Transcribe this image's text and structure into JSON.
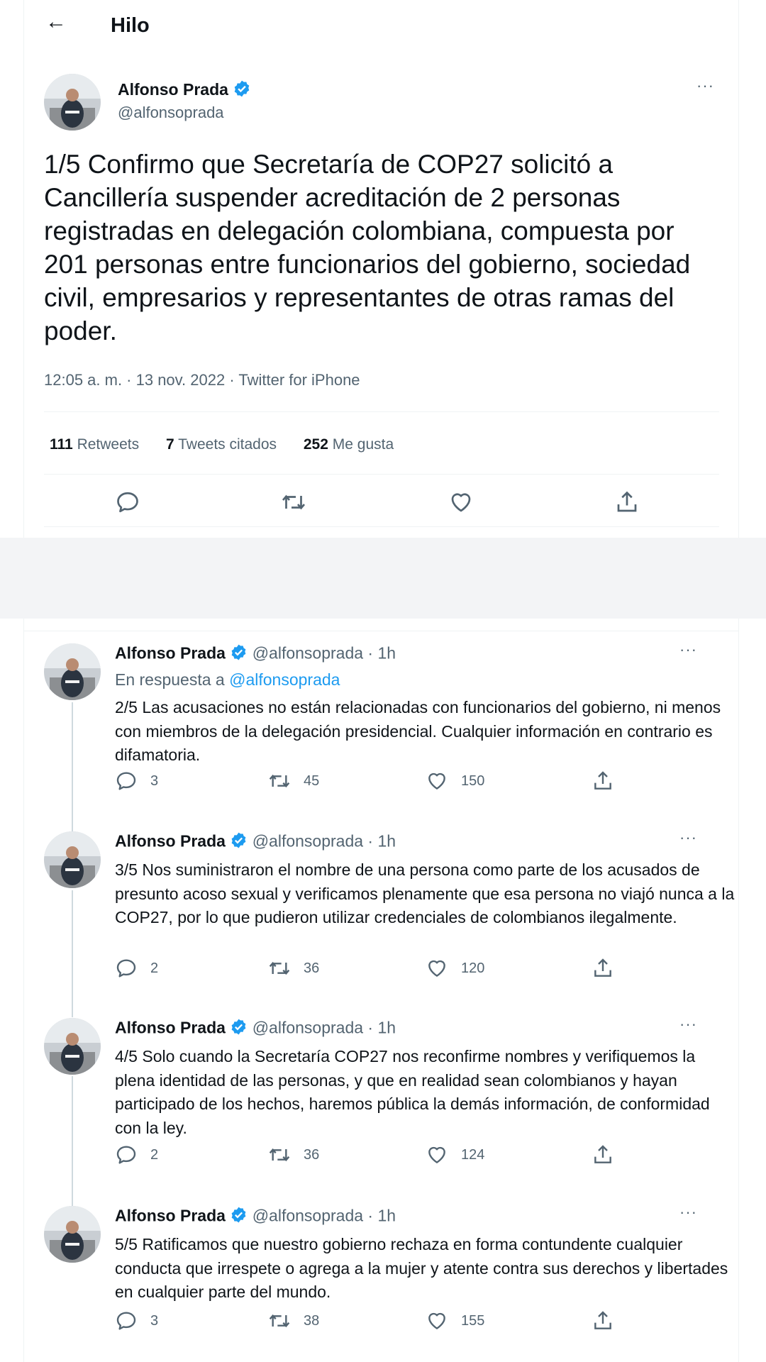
{
  "header": {
    "back_icon": "arrow-left-icon",
    "title": "Hilo"
  },
  "main_tweet": {
    "author_name": "Alfonso Prada",
    "author_handle": "@alfonsoprada",
    "text": "1/5 Confirmo que Secretaría de COP27 solicitó a Cancillería suspender acreditación de 2 personas registradas en delegación colombiana, compuesta por 201 personas entre funcionarios del gobierno, sociedad civil, empresarios y representantes de otras ramas del poder.",
    "meta": "12:05 a. m. · 13 nov. 2022 · Twitter for iPhone",
    "stats": {
      "retweets_count": "111",
      "retweets_label": "Retweets",
      "quotes_count": "7",
      "quotes_label": "Tweets citados",
      "likes_count": "252",
      "likes_label": "Me gusta"
    },
    "more_label": "···"
  },
  "replies": [
    {
      "author_name": "Alfonso Prada",
      "handle_time": "@alfonsoprada · 1h",
      "reply_prefix": "En respuesta a",
      "reply_to": "@alfonsoprada",
      "text": "2/5 Las acusaciones no están relacionadas con funcionarios del gobierno, ni menos con miembros de la delegación presidencial. Cualquier información en contrario es difamatoria.",
      "replies": "3",
      "retweets": "45",
      "likes": "150",
      "more_label": "···"
    },
    {
      "author_name": "Alfonso Prada",
      "handle_time": "@alfonsoprada · 1h",
      "text": "3/5 Nos suministraron el nombre de una persona como parte de los acusados de presunto acoso sexual y verificamos plenamente que esa persona no viajó nunca a la COP27, por lo que pudieron utilizar credenciales de colombianos ilegalmente.",
      "replies": "2",
      "retweets": "36",
      "likes": "120",
      "more_label": "···"
    },
    {
      "author_name": "Alfonso Prada",
      "handle_time": "@alfonsoprada · 1h",
      "text": "4/5 Solo cuando la Secretaría COP27 nos reconfirme nombres y verifiquemos la plena identidad de las personas, y que en realidad sean colombianos y hayan participado de los hechos,  haremos pública la demás información, de conformidad con la ley.",
      "replies": "2",
      "retweets": "36",
      "likes": "124",
      "more_label": "···"
    },
    {
      "author_name": "Alfonso Prada",
      "handle_time": "@alfonsoprada · 1h",
      "text": "5/5 Ratificamos que nuestro gobierno rechaza en forma contundente cualquier conducta que irrespete o agrega a la mujer y atente contra sus derechos y libertades en cualquier parte del mundo.",
      "replies": "3",
      "retweets": "38",
      "likes": "155",
      "more_label": "···"
    }
  ],
  "colors": {
    "accent": "#1d9bf0",
    "secondary_text": "#536471",
    "divider": "#eff3f4"
  }
}
